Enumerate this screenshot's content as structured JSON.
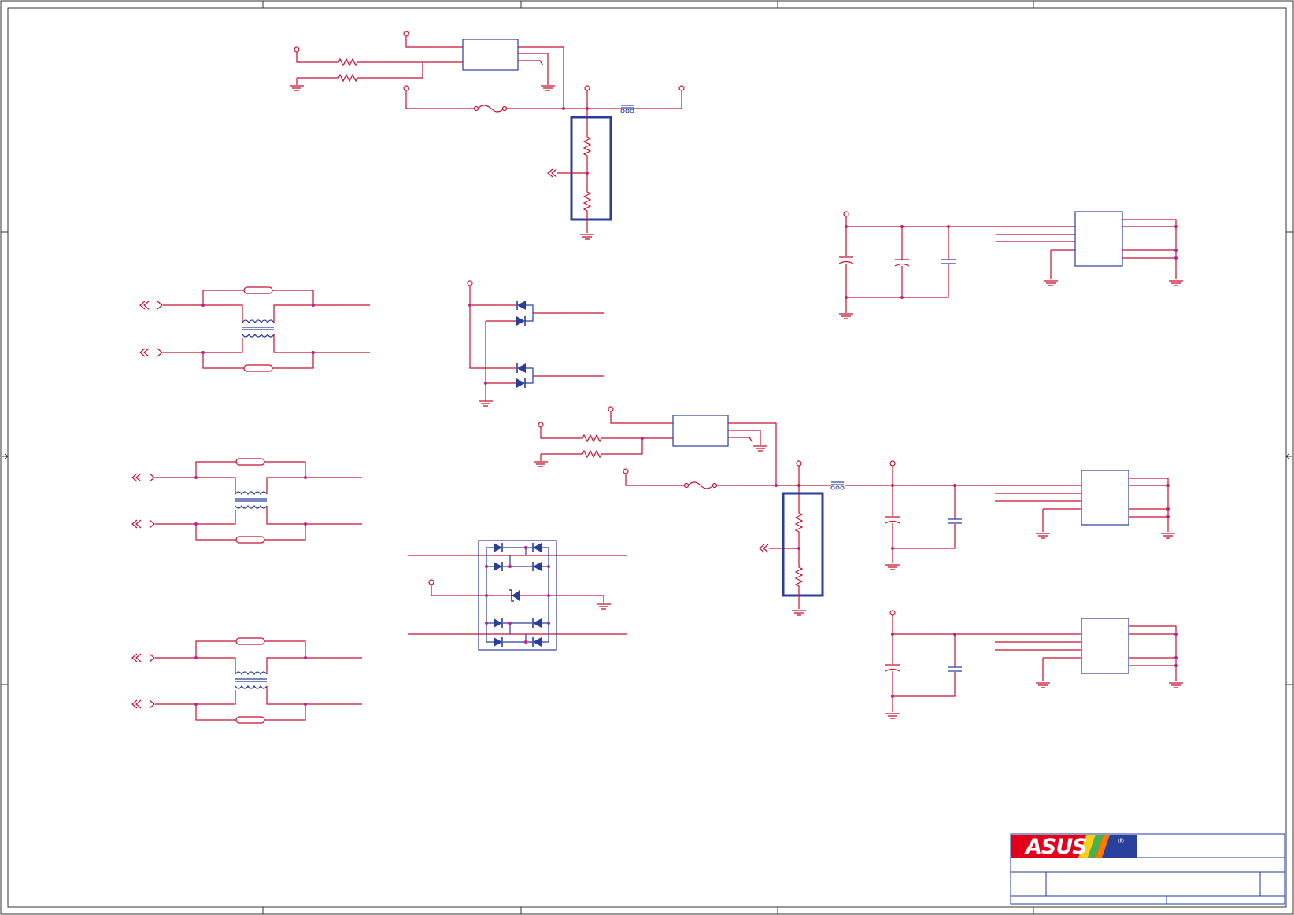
{
  "title_block": {
    "logo_text": "ASUS",
    "registered_mark": "®",
    "logo_colors": {
      "left": "#e3001b",
      "right": "#2b3f9c",
      "stripes": [
        "#f7d117",
        "#4caf50",
        "#ff7a00",
        "#ffffff"
      ]
    }
  },
  "colors": {
    "wire": "#c8102e",
    "net": "#b0005a",
    "component": "#2a3d9c",
    "junction": "#c02090",
    "frame": "#333333"
  },
  "icons": {
    "ground": "ground-icon",
    "power_pin": "power-pin-icon",
    "off_page_connector": "off-page-connector-icon",
    "resistor": "resistor-icon",
    "fuse": "fuse-icon",
    "ferrite": "ferrite-bead-icon",
    "diode": "diode-icon",
    "zener": "zener-diode-icon",
    "transformer": "common-mode-choke-icon",
    "capacitor": "capacitor-icon",
    "ic": "ic-package-icon"
  }
}
